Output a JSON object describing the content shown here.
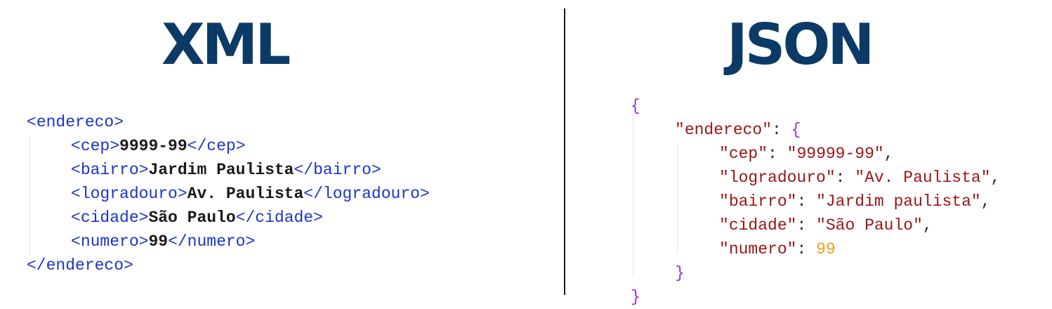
{
  "xml_panel": {
    "title": "XML",
    "root_tag": "endereco",
    "fields": [
      {
        "tag": "cep",
        "value": "9999-99"
      },
      {
        "tag": "bairro",
        "value": "Jardim Paulista"
      },
      {
        "tag": "logradouro",
        "value": "Av. Paulista"
      },
      {
        "tag": "cidade",
        "value": "São Paulo"
      },
      {
        "tag": "numero",
        "value": "99"
      }
    ]
  },
  "json_panel": {
    "title": "JSON",
    "root_key": "endereco",
    "fields": [
      {
        "key": "cep",
        "value": "\"99999-99\"",
        "is_number": false,
        "trailing_comma": true
      },
      {
        "key": "logradouro",
        "value": "\"Av. Paulista\"",
        "is_number": false,
        "trailing_comma": true
      },
      {
        "key": "bairro",
        "value": "\"Jardim paulista\"",
        "is_number": false,
        "trailing_comma": true
      },
      {
        "key": "cidade",
        "value": "\"São Paulo\"",
        "is_number": false,
        "trailing_comma": true
      },
      {
        "key": "numero",
        "value": "99",
        "is_number": true,
        "trailing_comma": false
      }
    ]
  },
  "colors": {
    "heading": "#0b3a66",
    "xml_tag": "#1a35c9",
    "json_brace": "#9a30d8",
    "json_string": "#9b1515",
    "json_number": "#f0a020"
  }
}
